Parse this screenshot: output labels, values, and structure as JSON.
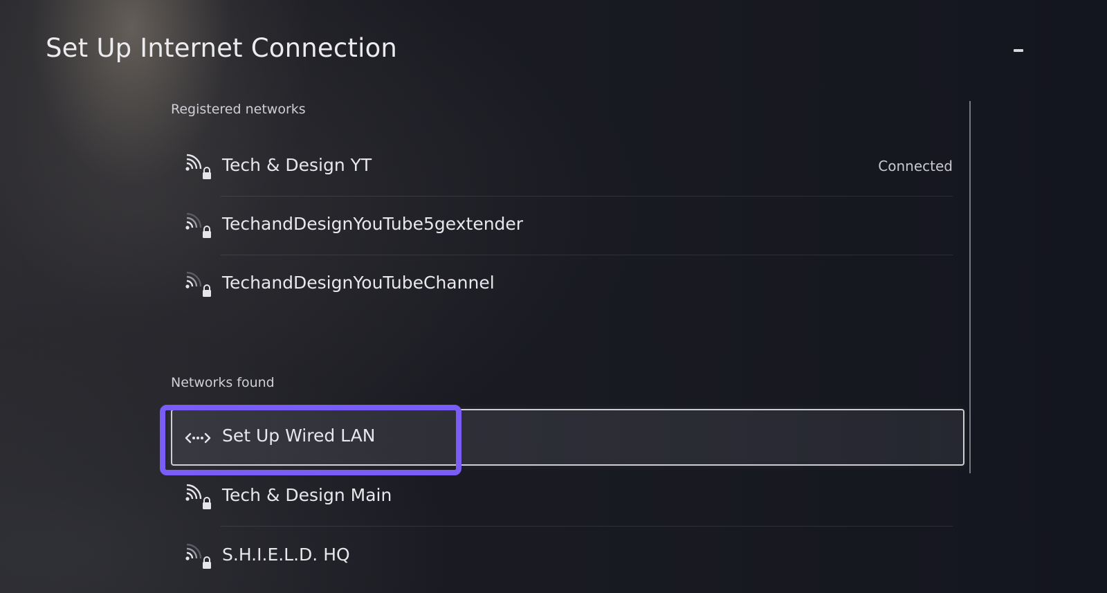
{
  "header": {
    "title": "Set Up Internet Connection"
  },
  "registered": {
    "label": "Registered networks",
    "networks": [
      {
        "name": "Tech & Design YT",
        "status": "Connected",
        "icon": "wifi-locked-icon"
      },
      {
        "name": "TechandDesignYouTube5gextender",
        "status": "",
        "icon": "wifi-locked-icon"
      },
      {
        "name": "TechandDesignYouTubeChannel",
        "status": "",
        "icon": "wifi-locked-icon"
      }
    ]
  },
  "found": {
    "label": "Networks found",
    "items": [
      {
        "name": "Set Up Wired LAN",
        "icon": "wired-lan-icon",
        "selected": true
      },
      {
        "name": "Tech & Design Main",
        "icon": "wifi-locked-icon"
      },
      {
        "name": "S.H.I.E.L.D. HQ",
        "icon": "wifi-locked-icon"
      }
    ]
  },
  "colors": {
    "highlight": "#7a5cf6",
    "background": "#13141c",
    "text": "#e8e8ec"
  }
}
